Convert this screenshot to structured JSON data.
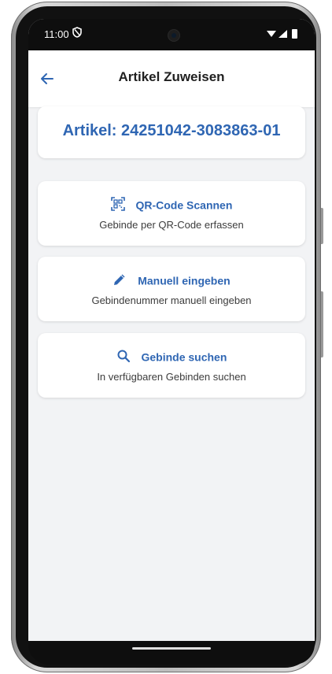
{
  "status_bar": {
    "time": "11:00",
    "icons": "▾◢▮"
  },
  "app_bar": {
    "title": "Artikel Zuweisen",
    "back_icon": "arrow-left-icon"
  },
  "article": {
    "label": "Artikel: 24251042-3083863-01"
  },
  "actions": [
    {
      "icon": "qr-code-scan-icon",
      "title": "QR-Code Scannen",
      "subtitle": "Gebinde per QR-Code erfassen"
    },
    {
      "icon": "pencil-icon",
      "title": "Manuell eingeben",
      "subtitle": "Gebindenummer manuell eingeben"
    },
    {
      "icon": "search-icon",
      "title": "Gebinde suchen",
      "subtitle": "In verfügbaren Gebinden suchen"
    }
  ],
  "colors": {
    "accent": "#2f66b3",
    "background": "#f2f3f5",
    "card": "#ffffff"
  }
}
